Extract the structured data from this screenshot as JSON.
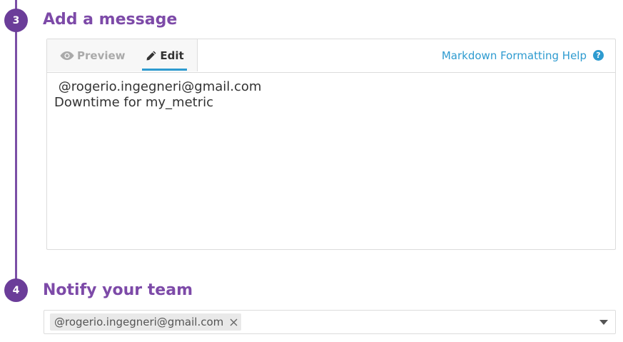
{
  "steps": [
    {
      "number": "3",
      "title": "Add a message"
    },
    {
      "number": "4",
      "title": "Notify your team"
    }
  ],
  "editor": {
    "tabs": {
      "preview": "Preview",
      "edit": "Edit"
    },
    "active_tab": "edit",
    "help_link": "Markdown Formatting Help",
    "help_icon": "question-circle-icon",
    "content": " @rogerio.ingegneri@gmail.com\nDowntime for my_metric"
  },
  "notify": {
    "tags": [
      "@rogerio.ingegneri@gmail.com"
    ],
    "remove_icon": "close-icon",
    "dropdown_icon": "caret-down-icon"
  },
  "colors": {
    "accent_purple": "#7d4aa8",
    "step_circle": "#6b3d99",
    "link_blue": "#2e9bd0"
  }
}
